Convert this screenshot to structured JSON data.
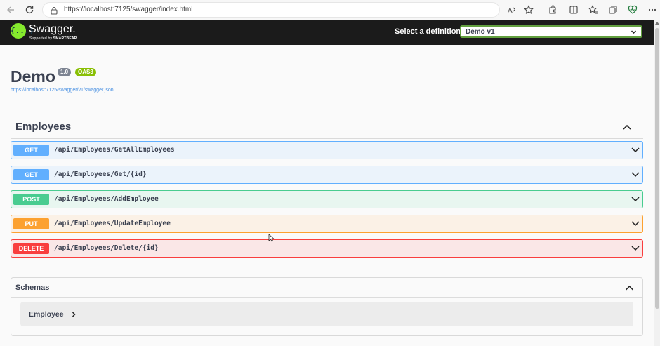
{
  "browser": {
    "url": "https://localhost:7125/swagger/index.html",
    "icons": [
      "back-icon",
      "refresh-icon",
      "lock-icon",
      "read-aloud-icon",
      "favorite-star-icon",
      "extensions-icon",
      "split-screen-icon",
      "favorites-icon",
      "collections-icon",
      "heart-health-icon",
      "more-icon"
    ]
  },
  "topbar": {
    "logo_text": "Swagger.",
    "logo_mark": "{...}",
    "logo_sub_prefix": "Supported by",
    "logo_sub_brand": "SMARTBEAR",
    "definition_label": "Select a definition",
    "definition_value": "Demo v1",
    "accent_color": "#85ea2d"
  },
  "info": {
    "title": "Demo",
    "version": "1.0",
    "oas": "OAS3",
    "spec_url": "https://localhost:7125/swagger/v1/swagger.json"
  },
  "tag": {
    "name": "Employees",
    "expanded": true
  },
  "operations": [
    {
      "method": "GET",
      "path": "/api/Employees/GetAllEmployees",
      "color": "#61affe"
    },
    {
      "method": "GET",
      "path": "/api/Employees/Get/{id}",
      "color": "#61affe"
    },
    {
      "method": "POST",
      "path": "/api/Employees/AddEmployee",
      "color": "#49cc90"
    },
    {
      "method": "PUT",
      "path": "/api/Employees/UpdateEmployee",
      "color": "#fca130"
    },
    {
      "method": "DELETE",
      "path": "/api/Employees/Delete/{id}",
      "color": "#f93e3e"
    }
  ],
  "schemas": {
    "title": "Schemas",
    "models": [
      {
        "name": "Employee"
      }
    ]
  }
}
